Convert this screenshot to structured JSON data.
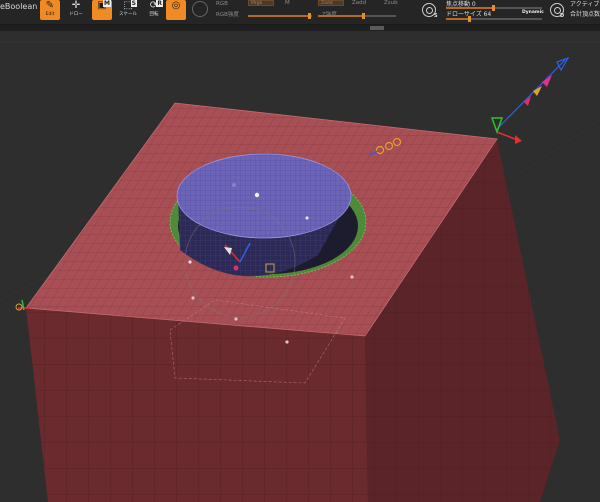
{
  "toolbar": {
    "document_name": "eBoolean",
    "edit_label": "Edit",
    "move_label": "ドロー",
    "scale_label": "スケール",
    "rotate_label": "回転",
    "rgb_label": "RGB",
    "rgb_intensity_label": "RGB強度",
    "m_label": "M",
    "zadd_label": "Zadd",
    "zsub_label": "Zsub",
    "z_intensity_label": "Z強度",
    "focal_shift_label": "焦点移動 0",
    "draw_size_label": "ドローサイズ 64",
    "dynamic_label": "Dynamic",
    "active_points_label": "アクティブ",
    "total_points_label": "合計頂点数",
    "focal_shift_value": 0,
    "draw_size_value": 64,
    "accent_color": "#f08a24"
  },
  "viewport": {
    "icons": [
      "transpose-line-icon",
      "gizmo-axis-icon",
      "gizmo-pivot-icon"
    ],
    "colors": {
      "background": "#2e2e2e",
      "box_top": "#a84f55",
      "box_side": "#6a2a2e",
      "cylinder_top": "#6b64b8",
      "cylinder_side": "#2c2a55",
      "boolean_ring": "#4f8a3a",
      "gizmo_x": "#e03030",
      "gizmo_y": "#30c030",
      "gizmo_z": "#3060e0"
    }
  }
}
